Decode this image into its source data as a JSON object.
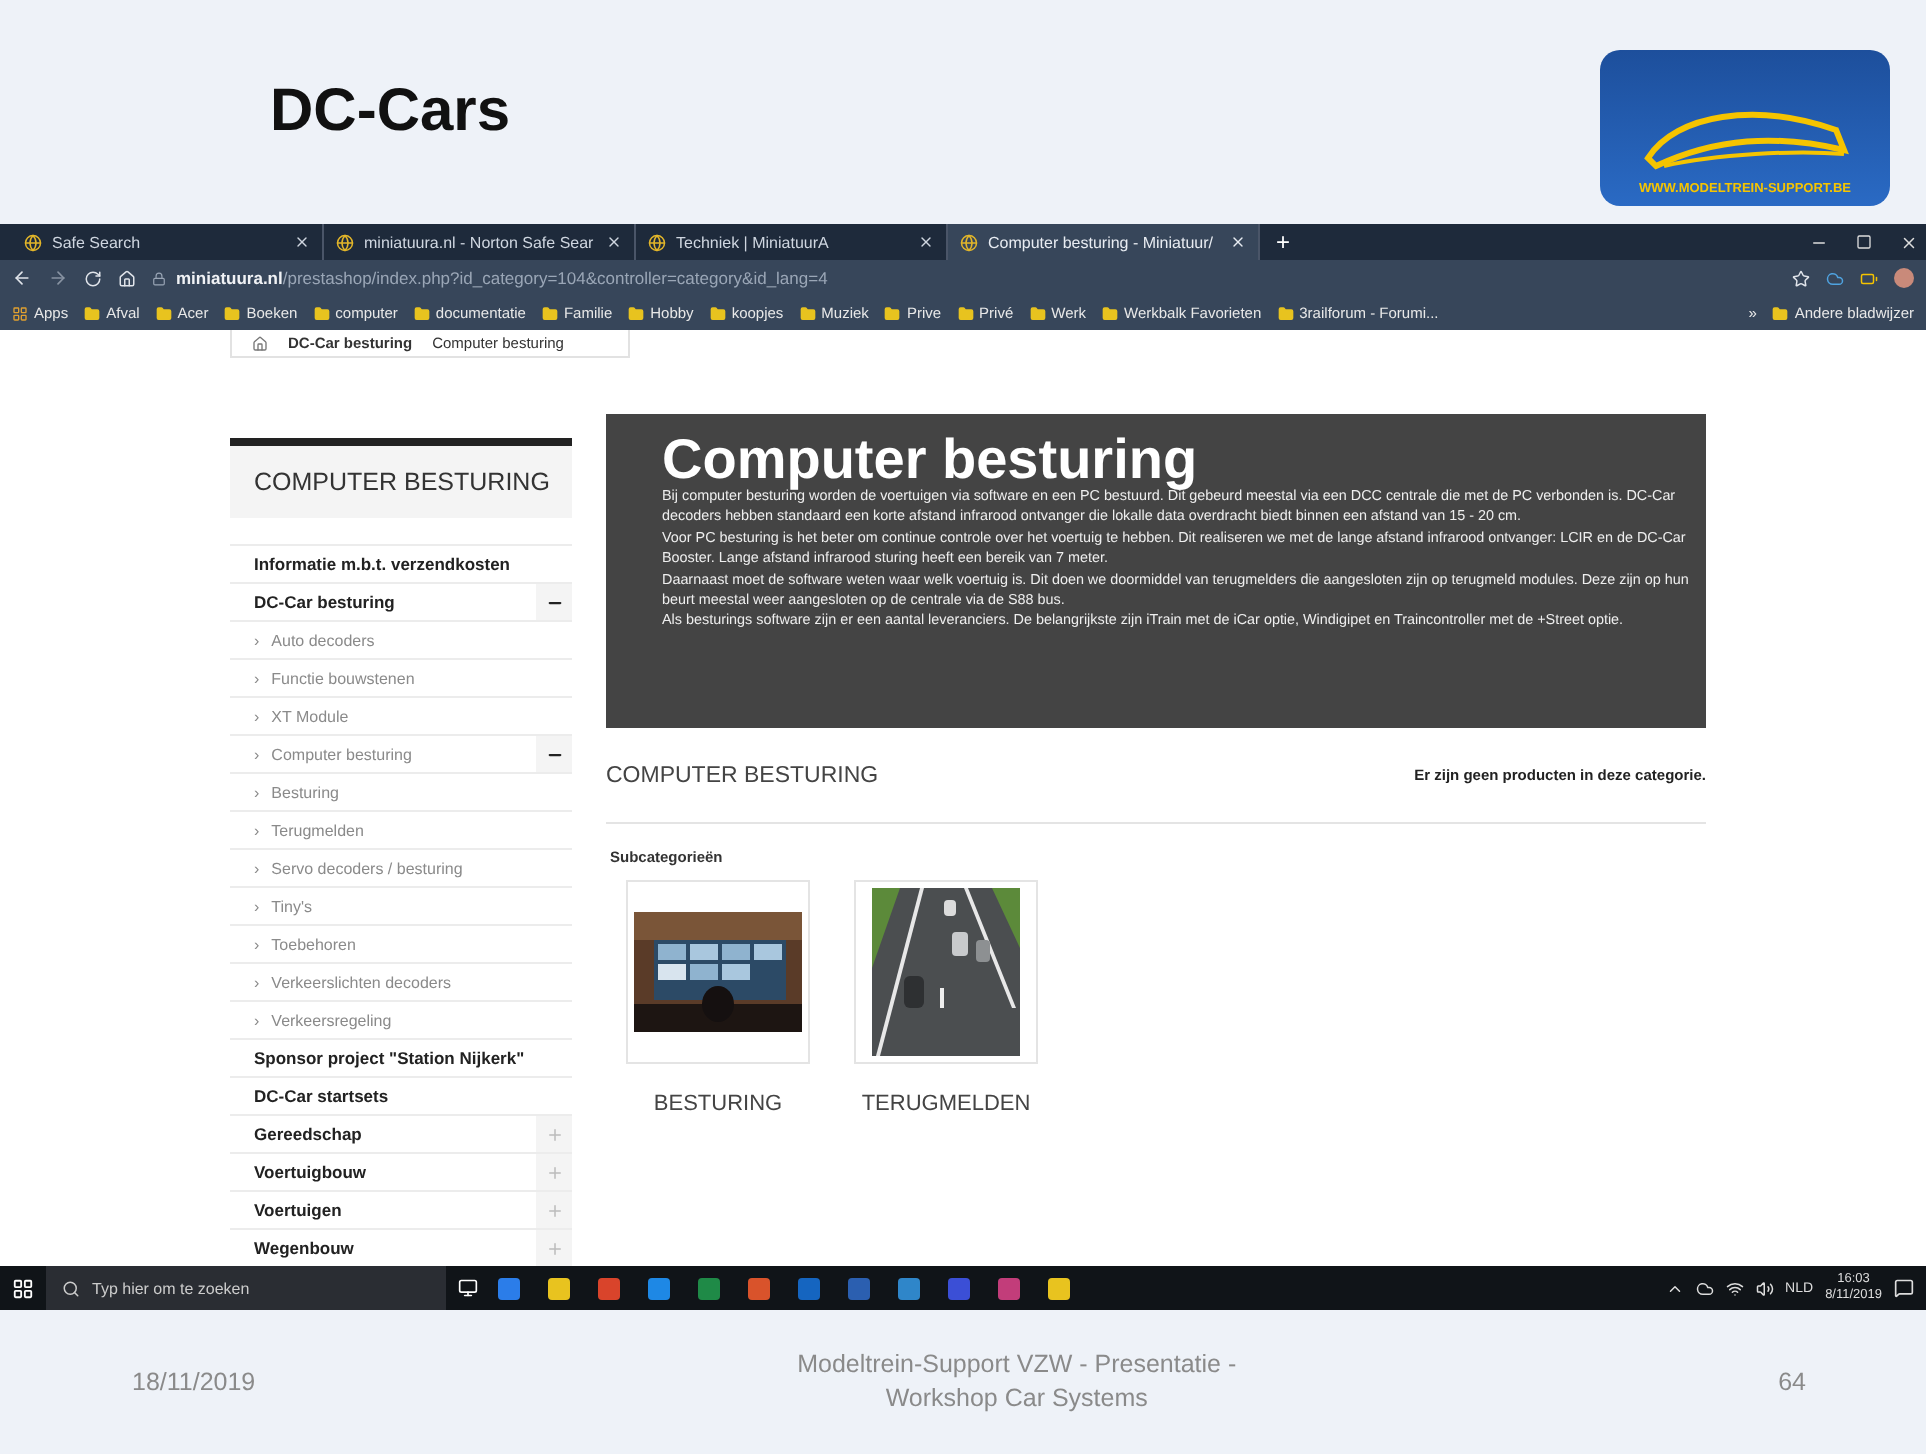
{
  "slide": {
    "title": "DC-Cars",
    "logo_text": "WWW.MODELTREIN-SUPPORT.BE",
    "footer": {
      "date": "18/11/2019",
      "center": "Modeltrein-Support  VZW - Presentatie - Workshop  Car Systems",
      "page": "64"
    }
  },
  "browser": {
    "tabs": [
      {
        "title": "Safe Search",
        "selected": false
      },
      {
        "title": "miniatuura.nl - Norton Safe Sear",
        "selected": false
      },
      {
        "title": "Techniek | MiniatuurA",
        "selected": false
      },
      {
        "title": "Computer besturing - Miniatuur/",
        "selected": true
      }
    ],
    "new_tab": "+",
    "url": {
      "domain": "miniatuura.nl",
      "path": "/prestashop/index.php?id_category=104&controller=category&id_lang=4"
    },
    "bookmarks": [
      "Apps",
      "Afval",
      "Acer",
      "Boeken",
      "computer",
      "documentatie",
      "Familie",
      "Hobby",
      "koopjes",
      "Muziek",
      "Prive",
      "Privé",
      "Werk",
      "Werkbalk Favorieten",
      "3railforum - Forumi..."
    ],
    "more": "»",
    "other_bookmarks": "Andere bladwijzer"
  },
  "breadcrumb": [
    "DC-Car besturing",
    "Computer besturing"
  ],
  "sidebar": {
    "title": "COMPUTER BESTURING",
    "items": [
      {
        "kind": "top",
        "label": "Informatie m.b.t. verzendkosten"
      },
      {
        "kind": "top",
        "label": "DC-Car besturing",
        "expanded": true
      },
      {
        "kind": "sub",
        "marker": "›",
        "label": "Auto decoders"
      },
      {
        "kind": "sub",
        "marker": "›",
        "label": "Functie bouwstenen"
      },
      {
        "kind": "sub",
        "marker": "›",
        "label": "XT Module"
      },
      {
        "kind": "sub",
        "marker": "›",
        "label": "Computer besturing",
        "expanded": true
      },
      {
        "kind": "sub",
        "marker": "›",
        "label": "Besturing"
      },
      {
        "kind": "sub",
        "marker": "›",
        "label": "Terugmelden"
      },
      {
        "kind": "sub",
        "marker": "›",
        "label": "Servo decoders / besturing"
      },
      {
        "kind": "sub",
        "marker": "›",
        "label": "Tiny's"
      },
      {
        "kind": "sub",
        "marker": "›",
        "label": "Toebehoren"
      },
      {
        "kind": "sub",
        "marker": "›",
        "label": "Verkeerslichten decoders"
      },
      {
        "kind": "sub",
        "marker": "›",
        "label": "Verkeersregeling"
      },
      {
        "kind": "top",
        "label": "Sponsor project \"Station Nijkerk\""
      },
      {
        "kind": "top",
        "label": "DC-Car startsets"
      },
      {
        "kind": "top",
        "label": "Gereedschap",
        "expanded": false
      },
      {
        "kind": "top",
        "label": "Voertuigbouw",
        "expanded": false
      },
      {
        "kind": "top",
        "label": "Voertuigen",
        "expanded": false
      },
      {
        "kind": "top",
        "label": "Wegenbouw",
        "expanded": false
      }
    ]
  },
  "banner": {
    "title": "Computer besturing",
    "paragraphs": [
      "Bij computer besturing worden de voertuigen via software en een PC bestuurd. Dit gebeurd meestal via een DCC centrale die met de PC verbonden is. DC-Car decoders hebben standaard een korte afstand infrarood ontvanger die lokalle data overdracht biedt binnen een afstand van 15 - 20 cm.",
      "Voor PC besturing is het beter om continue controle over het voertuig te hebben. Dit realiseren we met de lange afstand infrarood ontvanger: LCIR en de DC-Car Booster. Lange afstand infrarood sturing heeft een bereik van 7 meter.",
      "Daarnaast moet de software weten waar welk voertuig is. Dit doen we doormiddel van terugmelders die aangesloten zijn op terugmeld modules. Deze zijn op hun beurt meestal weer aangesloten op de centrale via de S88 bus.",
      "Als besturings software zijn er een aantal leveranciers. De belangrijkste zijn iTrain met de iCar optie, Windigipet en Traincontroller met de +Street optie."
    ]
  },
  "category": {
    "heading": "COMPUTER BESTURING",
    "notice": "Er zijn geen producten in deze categorie.",
    "sub_heading": "Subcategorieën",
    "subcategories": [
      {
        "label": "BESTURING",
        "kind": "picture"
      },
      {
        "label": "TERUGMELDEN",
        "kind": "picture"
      }
    ]
  },
  "taskbar": {
    "search_placeholder": "Typ hier om te zoeken",
    "language": "NLD",
    "time": "16:03",
    "date": "8/11/2019"
  }
}
